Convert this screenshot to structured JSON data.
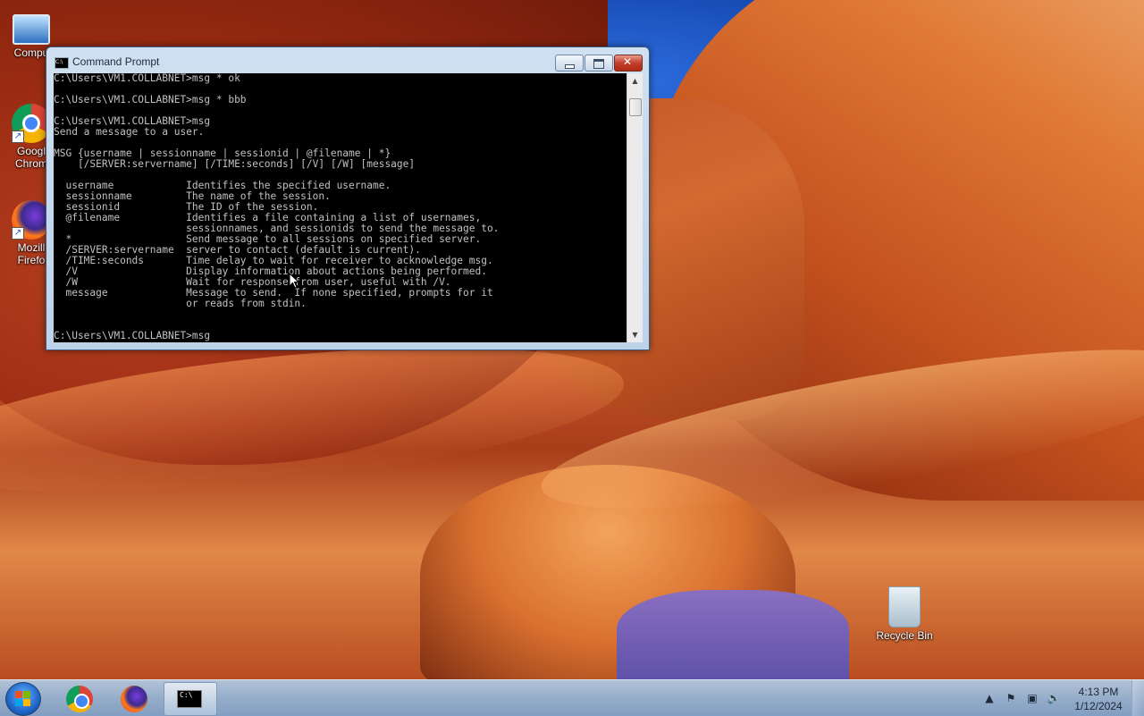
{
  "desktop": {
    "icons": [
      {
        "label": "Computer",
        "visible_label": "Compu"
      },
      {
        "label_line1": "Googl",
        "label_line2": "Chrom"
      },
      {
        "label_line1": "Mozill",
        "label_line2": "Firefo"
      },
      {
        "label": "Recycle Bin"
      }
    ]
  },
  "window": {
    "title": "Command Prompt",
    "icon_text": "C:\\",
    "console_lines": [
      "C:\\Users\\VM1.COLLABNET>msg * ok",
      "",
      "C:\\Users\\VM1.COLLABNET>msg * bbb",
      "",
      "C:\\Users\\VM1.COLLABNET>msg",
      "Send a message to a user.",
      "",
      "MSG {username | sessionname | sessionid | @filename | *}",
      "    [/SERVER:servername] [/TIME:seconds] [/V] [/W] [message]",
      "",
      "  username            Identifies the specified username.",
      "  sessionname         The name of the session.",
      "  sessionid           The ID of the session.",
      "  @filename           Identifies a file containing a list of usernames,",
      "                      sessionnames, and sessionids to send the message to.",
      "  *                   Send message to all sessions on specified server.",
      "  /SERVER:servername  server to contact (default is current).",
      "  /TIME:seconds       Time delay to wait for receiver to acknowledge msg.",
      "  /V                  Display information about actions being performed.",
      "  /W                  Wait for response from user, useful with /V.",
      "  message             Message to send.  If none specified, prompts for it",
      "                      or reads from stdin.",
      "",
      "",
      "C:\\Users\\VM1.COLLABNET>msg"
    ]
  },
  "taskbar": {
    "apps": [
      "start-orb",
      "google-chrome",
      "mozilla-firefox",
      "command-prompt"
    ],
    "clock": {
      "time": "4:13 PM",
      "date": "1/12/2024"
    }
  }
}
